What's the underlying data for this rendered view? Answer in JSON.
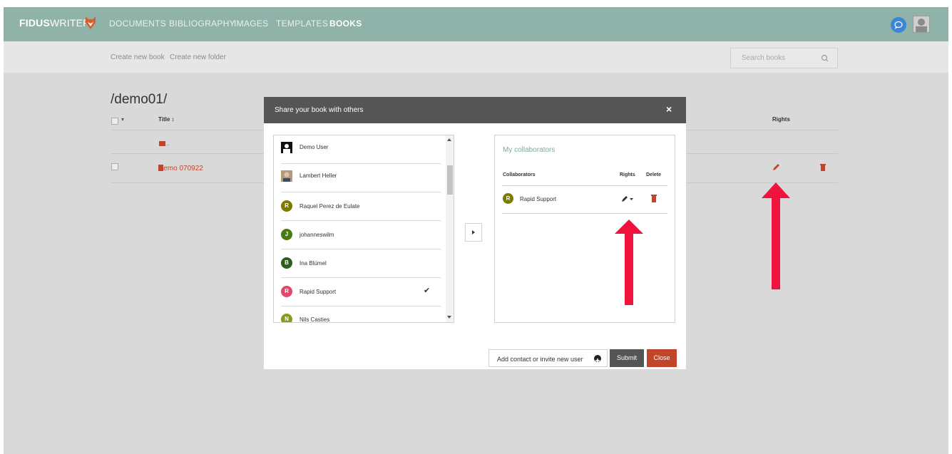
{
  "app": {
    "logo_bold": "FIDUS",
    "logo_light": "WRITER",
    "nav": [
      "DOCUMENTS",
      "BIBLIOGRAPHY",
      "IMAGES",
      "TEMPLATES",
      "BOOKS"
    ],
    "active_nav": "BOOKS",
    "accent": "#8fb3a9",
    "brand_red": "#c0452a"
  },
  "toolbar": {
    "create_book": "Create new book",
    "create_folder": "Create new folder",
    "search_placeholder": "Search books"
  },
  "list": {
    "path": "/demo01/",
    "col_title": "Title ↕",
    "col_rights": "Rights",
    "folder_up": "..",
    "book_title": "Demo 070922"
  },
  "dialog": {
    "title": "Share your book with others",
    "close_icon": "×",
    "contacts": [
      {
        "name": "Demo User",
        "initial": "",
        "avatar_color": "#111111",
        "avatar": "default-user-icon",
        "checked": false
      },
      {
        "name": "Lambert Heller",
        "initial": "",
        "avatar_color": "#8b6b4a",
        "avatar": "photo",
        "checked": false
      },
      {
        "name": "Raquel Perez de Eulate",
        "initial": "R",
        "avatar_color": "#7d7a00",
        "checked": false
      },
      {
        "name": "johanneswilm",
        "initial": "J",
        "avatar_color": "#4a7a14",
        "checked": false
      },
      {
        "name": "Ina Blümel",
        "initial": "B",
        "avatar_color": "#2f5e1c",
        "checked": false
      },
      {
        "name": "Rapid Support",
        "initial": "R",
        "avatar_color": "#e2476b",
        "checked": true
      },
      {
        "name": "Nils Casties",
        "initial": "N",
        "avatar_color": "#8a9a1e",
        "checked": false
      }
    ],
    "collaborators_title": "My collaborators",
    "col_collaborators": "Collaborators",
    "col_rights": "Rights",
    "col_delete": "Delete",
    "collaborators": [
      {
        "name": "Rapid Support",
        "initial": "R",
        "avatar_color": "#7d7a00",
        "rights_icon": "pencil-icon"
      }
    ],
    "add_contact_label": "Add contact or invite new user",
    "submit_label": "Submit",
    "close_label": "Close"
  }
}
